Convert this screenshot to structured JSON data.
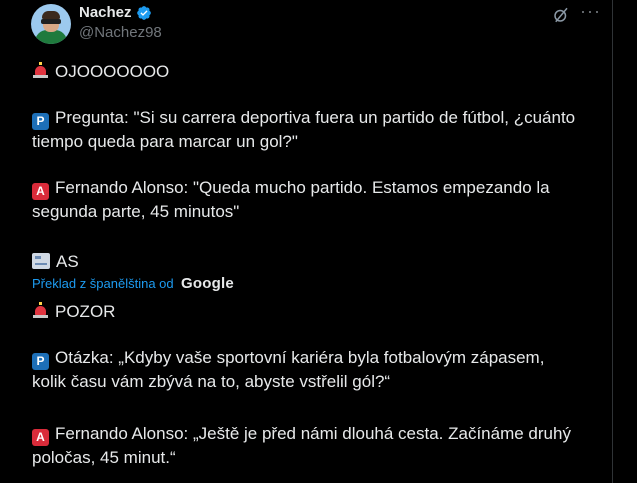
{
  "author": {
    "name": "Nachez",
    "handle": "@Nachez98"
  },
  "tweet": {
    "lines": {
      "l1": "OJOOOOOOO",
      "l2a": "Pregunta: \"Si su carrera deportiva fuera un partido de fútbol, ¿cuánto",
      "l2b": "tiempo queda para marcar un gol?\"",
      "l3a": "Fernando Alonso: \"Queda mucho partido. Estamos empezando la",
      "l3b": "segunda parte, 45 minutos\"",
      "l4": "AS"
    }
  },
  "translation": {
    "notice": "Překlad z španělština od",
    "provider": "Google",
    "lines": {
      "t1": "POZOR",
      "t2a": "Otázka: „Kdyby vaše sportovní kariéra byla fotbalovým zápasem,",
      "t2b": "kolik času vám zbývá na to, abyste vstřelil gól?“",
      "t3a": "Fernando Alonso: „Ještě je před námi dlouhá cesta. Začínáme druhý",
      "t3b": "poločas, 45 minut.“"
    }
  },
  "icons": {
    "verified": "verified-badge-icon",
    "grok": "grok-icon",
    "more": "more-icon",
    "siren": "rotating-light-icon",
    "p_button": "p-button-icon",
    "a_button": "a-button-icon",
    "newspaper": "newspaper-icon"
  },
  "colors": {
    "background": "#000000",
    "text": "#e7e9ea",
    "muted": "#71767b",
    "link": "#1d9bf0"
  }
}
